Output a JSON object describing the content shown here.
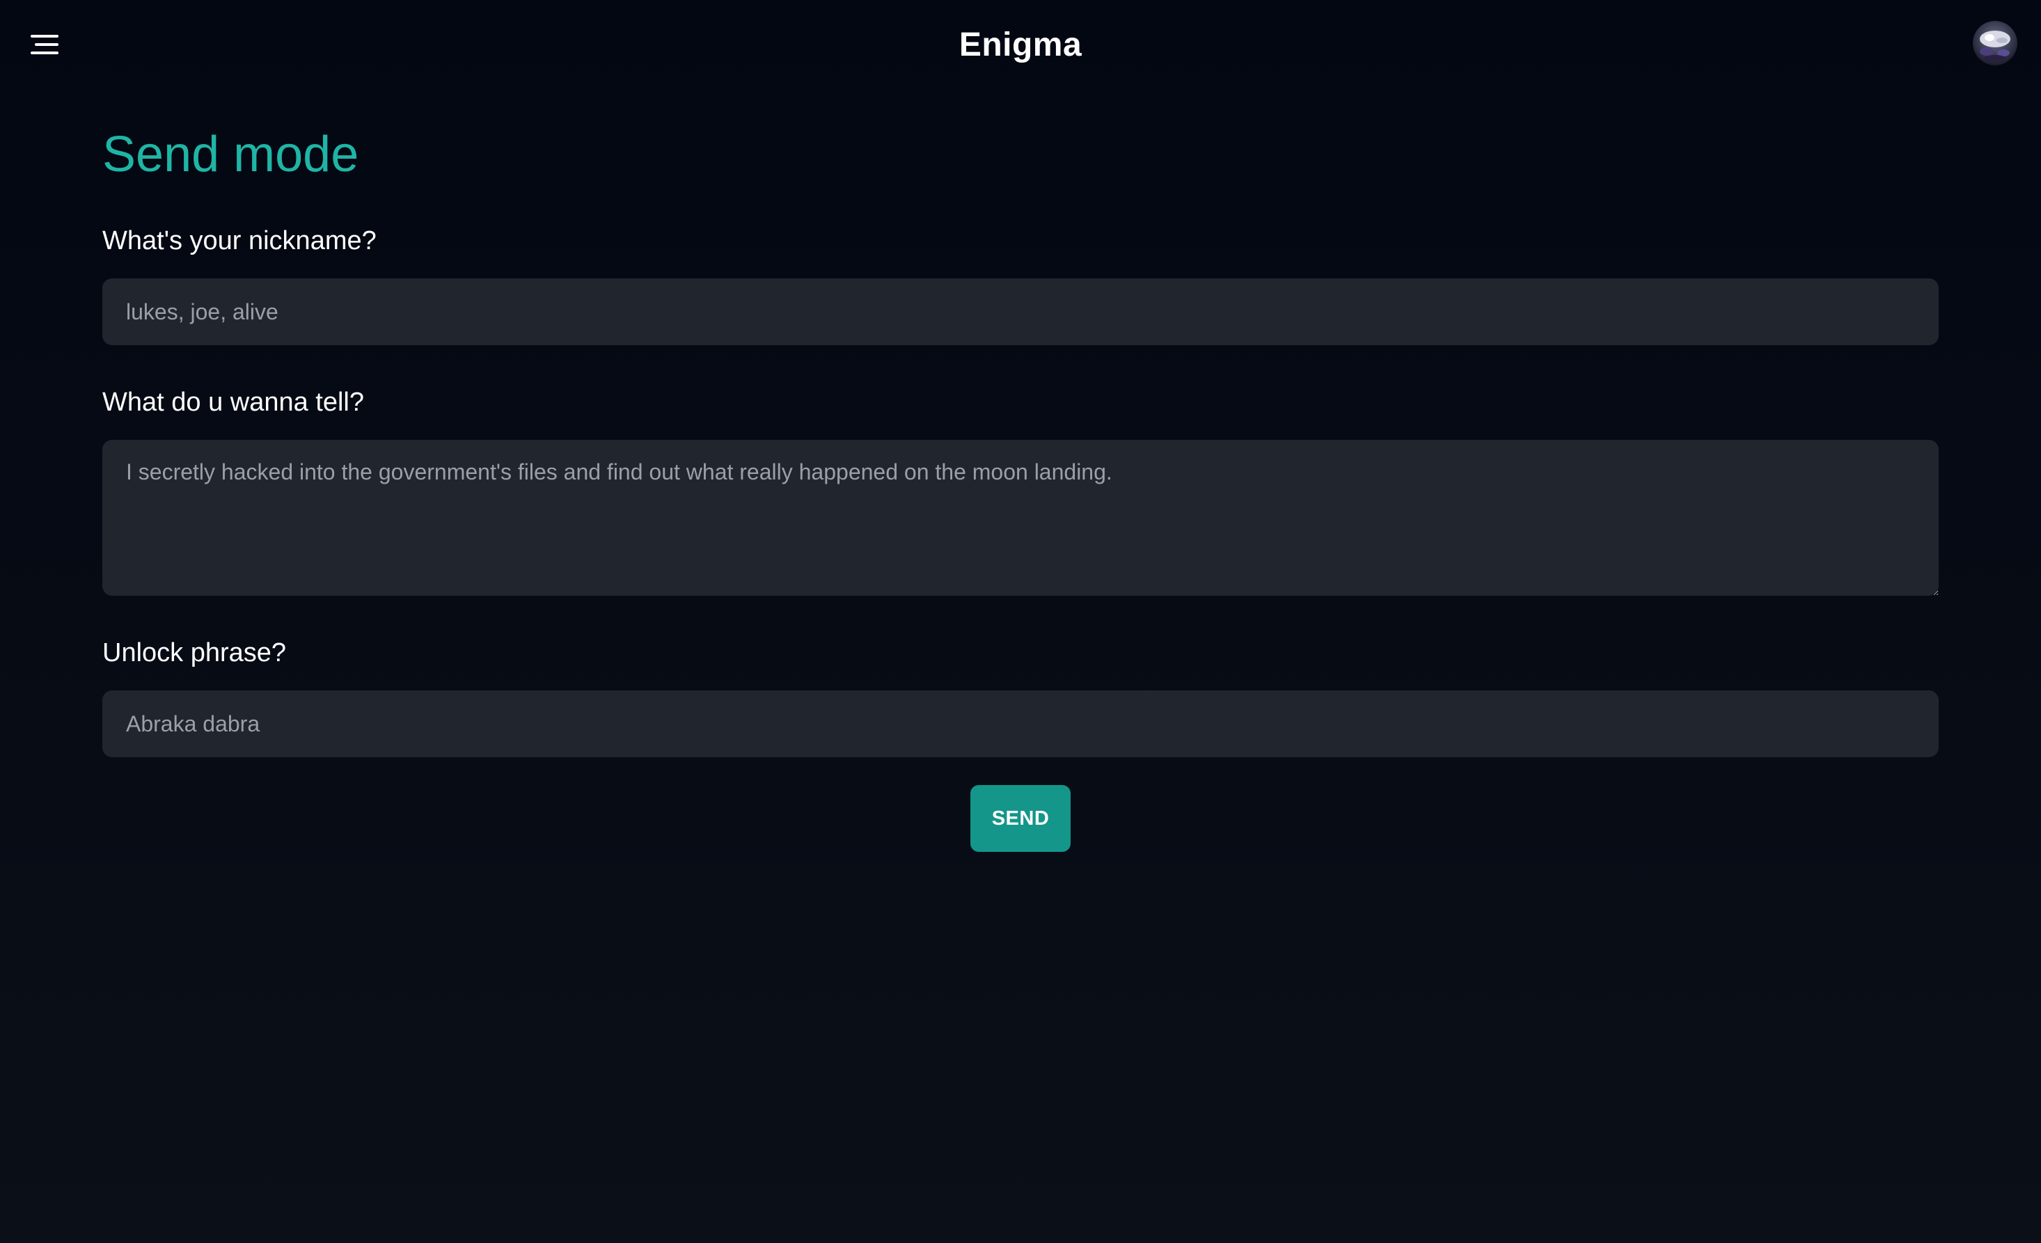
{
  "header": {
    "title": "Enigma",
    "menu_icon": "hamburger-menu-icon",
    "avatar_icon": "user-avatar"
  },
  "form": {
    "title": "Send mode",
    "nickname": {
      "label": "What's your nickname?",
      "placeholder": "lukes, joe, alive",
      "value": ""
    },
    "message": {
      "label": "What do u wanna tell?",
      "placeholder": "I secretly hacked into the government's files and find out what really happened on the moon landing.",
      "value": ""
    },
    "unlock": {
      "label": "Unlock phrase?",
      "placeholder": "Abraka dabra",
      "value": ""
    },
    "send_label": "SEND"
  },
  "colors": {
    "background_top": "#030712",
    "background_bottom": "#0b0f17",
    "accent": "#1fb5a5",
    "button": "#14968a",
    "field_bg": "#21252e",
    "placeholder": "#9aa0a8",
    "text": "#ffffff"
  }
}
